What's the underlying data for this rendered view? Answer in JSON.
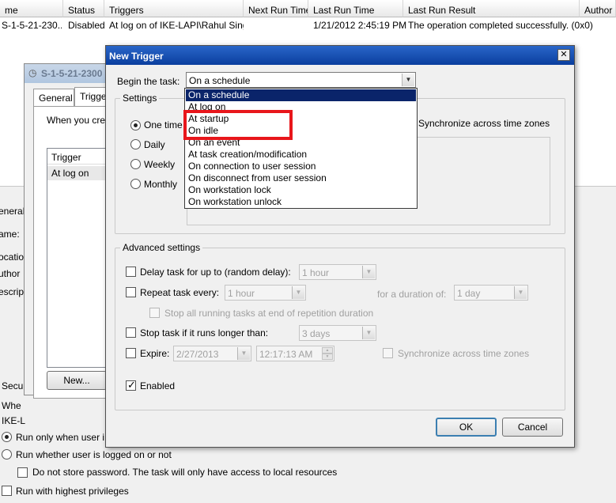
{
  "task_list": {
    "columns": [
      "me",
      "Status",
      "Triggers",
      "Next Run Time",
      "Last Run Time",
      "Last Run Result",
      "Author"
    ],
    "row": {
      "name": "S-1-5-21-230...",
      "status": "Disabled",
      "triggers": "At log on of IKE-LAPI\\Rahul Singla",
      "next_run": "",
      "last_run": "1/21/2012 2:45:19 PM",
      "last_result": "The operation completed successfully. (0x0)"
    }
  },
  "background_dialog": {
    "title": "S-1-5-21-2300",
    "tabs": [
      "General",
      "Trigge"
    ],
    "intro": "When you cre",
    "trigger_header": "Trigger",
    "trigger_item": "At log on",
    "new_button": "New..."
  },
  "lower_panel": {
    "tab_general": "eneral",
    "name_label": "ame:",
    "location_label": "ocatio",
    "author_label": "uthor",
    "description_label": "escrip",
    "security_label": "Secur",
    "when_label": "Whe",
    "user_label": "IKE-L",
    "run_only": "Run only when user i",
    "run_whether": "Run whether user is logged on or not",
    "do_not_store": "Do not store password.  The task will only have access to local resources",
    "highest_priv": "Run with highest privileges"
  },
  "dialog": {
    "title": "New Trigger",
    "close_symbol": "✕",
    "begin_label": "Begin the task:",
    "begin_value": "On a schedule",
    "settings_legend": "Settings",
    "radios": [
      "One time",
      "Daily",
      "Weekly",
      "Monthly"
    ],
    "sync_tz": "Synchronize across time zones",
    "advanced_legend": "Advanced settings",
    "delay_label": "Delay task for up to (random delay):",
    "delay_value": "1 hour",
    "repeat_label": "Repeat task every:",
    "repeat_value": "1 hour",
    "duration_label": "for a duration of:",
    "duration_value": "1 day",
    "stop_all_label": "Stop all running tasks at end of repetition duration",
    "stop_longer_label": "Stop task if it runs longer than:",
    "stop_longer_value": "3 days",
    "expire_label": "Expire:",
    "expire_date": "2/27/2013",
    "expire_time": "12:17:13 AM",
    "expire_sync": "Synchronize across time zones",
    "enabled_label": "Enabled",
    "ok": "OK",
    "cancel": "Cancel"
  },
  "dropdown_options": [
    "On a schedule",
    "At log on",
    "At startup",
    "On idle",
    "On an event",
    "At task creation/modification",
    "On connection to user session",
    "On disconnect from user session",
    "On workstation lock",
    "On workstation unlock"
  ],
  "colors": {
    "title_bar": "#0a3e9e",
    "selection": "#0a246a",
    "highlight_box": "#e8161b"
  }
}
